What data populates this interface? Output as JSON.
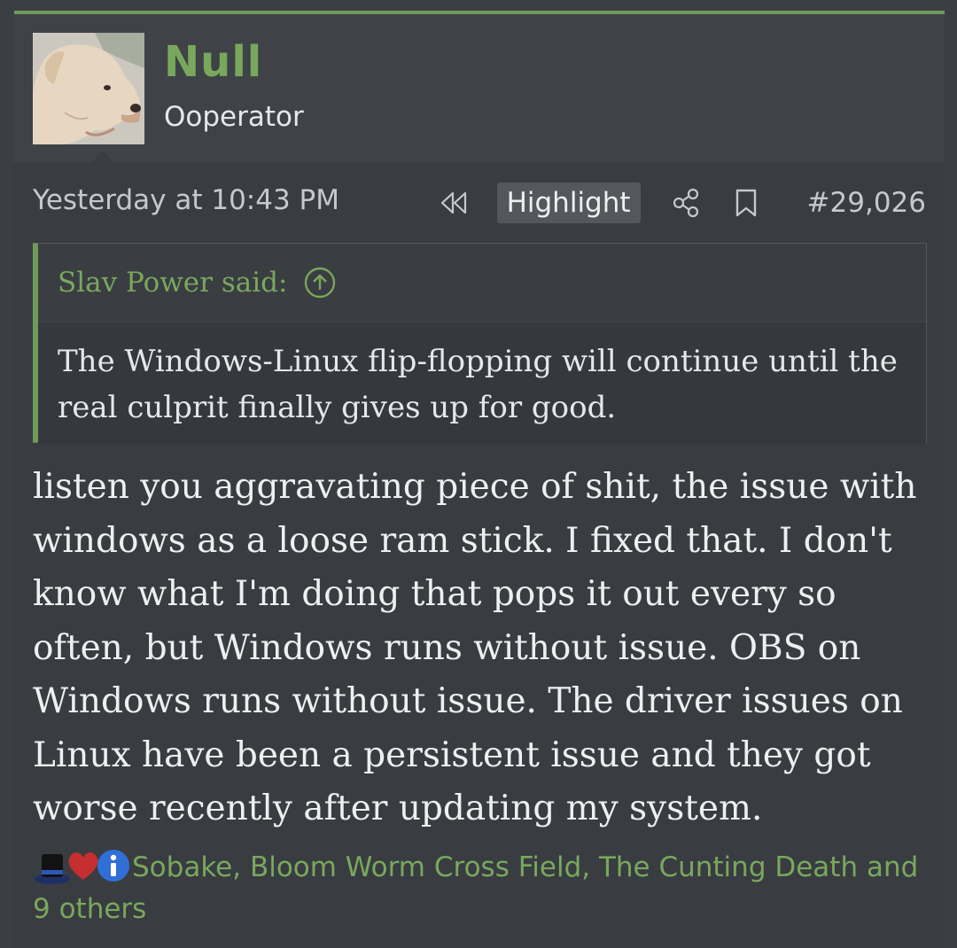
{
  "user": {
    "name": "Null",
    "title": "Ooperator"
  },
  "post": {
    "timestamp": "Yesterday at 10:43 PM",
    "highlight_label": "Highlight",
    "number": "#29,026",
    "quote": {
      "author": "Slav Power said:",
      "text": "The Windows-Linux flip-flopping will continue until the real culprit finally gives up for good."
    },
    "body": "listen you aggravating piece of shit, the issue with windows as a loose ram stick. I fixed that. I don't know what I'm doing that pops it out every so often, but Windows runs without issue. OBS on Windows runs without issue. The driver issues on Linux have been a persistent issue and they got worse recently after updating my system.",
    "reactions": {
      "icons": [
        "top-hat-icon",
        "heart-icon",
        "info-icon"
      ],
      "users_text": "Sobake, Bloom Worm Cross Field, The Cunting Death and 9 others"
    }
  },
  "colors": {
    "accent": "#6e9a5a",
    "username": "#79a85d",
    "background": "#393c41"
  }
}
